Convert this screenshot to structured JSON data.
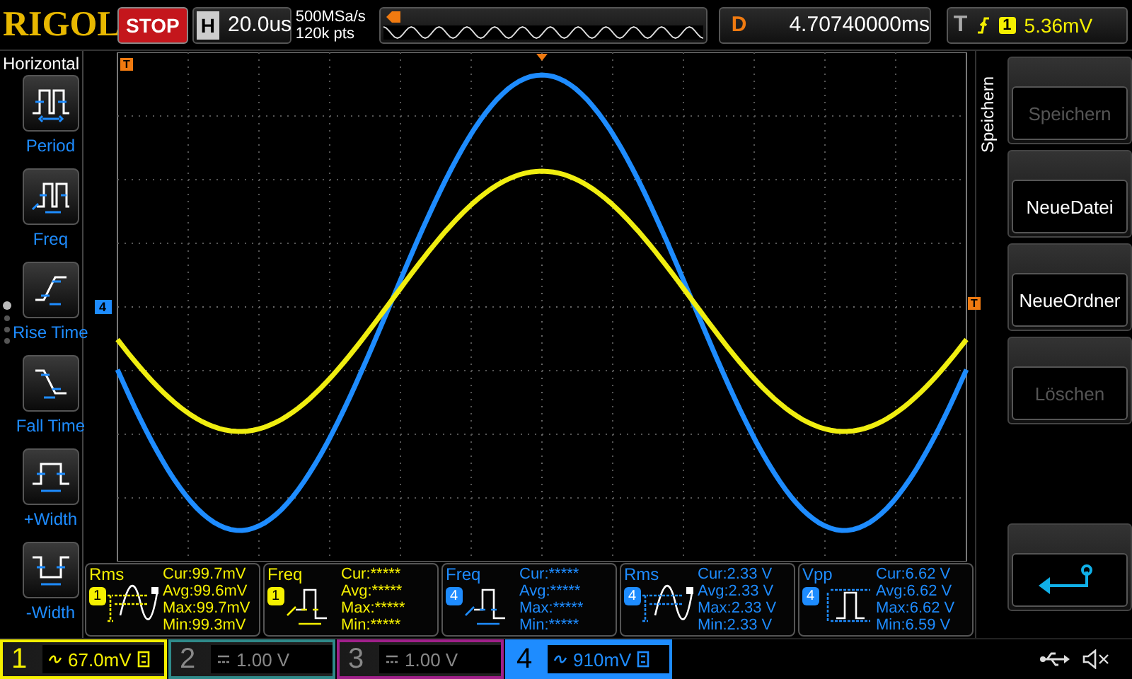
{
  "top_bar": {
    "brand": "RIGOL",
    "run_state": "STOP",
    "timebase": {
      "label": "H",
      "value": "20.0us"
    },
    "sample_rate": "500MSa/s",
    "memory_depth": "120k pts",
    "delay": {
      "label": "D",
      "value": "4.70740000ms"
    },
    "trigger": {
      "label": "T",
      "source": "1",
      "level": "5.36mV"
    }
  },
  "left_menu": {
    "title": "Horizontal",
    "items": [
      {
        "kind": "period",
        "label": "Period"
      },
      {
        "kind": "freq",
        "label": "Freq"
      },
      {
        "kind": "rise",
        "label": "Rise Time"
      },
      {
        "kind": "fall",
        "label": "Fall Time"
      },
      {
        "kind": "pwidth",
        "label": "+Width"
      },
      {
        "kind": "nwidth",
        "label": "-Width"
      }
    ],
    "pages": [
      {
        "selected": true
      },
      {
        "selected": false
      },
      {
        "selected": false
      },
      {
        "selected": false
      }
    ]
  },
  "screen": {
    "trigger_marker": "T",
    "channel_marker": "4",
    "level_marker": "T"
  },
  "measurements": [
    {
      "name": "Rms",
      "channel": "1",
      "color": "#f5f000",
      "kind": "sine",
      "cur": "Cur:99.7mV",
      "avg": "Avg:99.6mV",
      "max": "Max:99.7mV",
      "min": "Min:99.3mV"
    },
    {
      "name": "Freq",
      "channel": "1",
      "color": "#f5f000",
      "kind": "square",
      "cur": "Cur:*****",
      "avg": "Avg:*****",
      "max": "Max:*****",
      "min": "Min:*****"
    },
    {
      "name": "Freq",
      "channel": "4",
      "color": "#1e8cff",
      "kind": "square",
      "cur": "Cur:*****",
      "avg": "Avg:*****",
      "max": "Max:*****",
      "min": "Min:*****"
    },
    {
      "name": "Rms",
      "channel": "4",
      "color": "#1e8cff",
      "kind": "sine",
      "cur": "Cur:2.33 V",
      "avg": "Avg:2.33 V",
      "max": "Max:2.33 V",
      "min": "Min:2.33 V"
    },
    {
      "name": "Vpp",
      "channel": "4",
      "color": "#1e8cff",
      "kind": "pulse",
      "cur": "Cur:6.62 V",
      "avg": "Avg:6.62 V",
      "max": "Max:6.62 V",
      "min": "Min:6.59 V"
    }
  ],
  "channels": [
    {
      "number": "1",
      "kind": "ac",
      "scale": "67.0mV",
      "on": true,
      "selected": false,
      "bw_limit": true,
      "color": "#f5f000"
    },
    {
      "number": "2",
      "kind": "dc",
      "scale": "1.00 V",
      "on": false,
      "selected": false,
      "bw_limit": false,
      "color": "#2f8a8a"
    },
    {
      "number": "3",
      "kind": "dc",
      "scale": "1.00 V",
      "on": false,
      "selected": false,
      "bw_limit": false,
      "color": "#a0208a"
    },
    {
      "number": "4",
      "kind": "ac",
      "scale": "910mV",
      "on": true,
      "selected": true,
      "bw_limit": true,
      "color": "#1e8cff"
    }
  ],
  "right_menu": {
    "title": "Speichern",
    "buttons": [
      {
        "kind": "text",
        "label": "Speichern",
        "disabled": true
      },
      {
        "kind": "text",
        "label": "NeueDatei",
        "disabled": false
      },
      {
        "kind": "text",
        "label": "NeueOrdner",
        "disabled": false
      },
      {
        "kind": "text",
        "label": "Löschen",
        "disabled": true
      },
      {
        "kind": "spacer"
      },
      {
        "kind": "back"
      }
    ]
  }
}
